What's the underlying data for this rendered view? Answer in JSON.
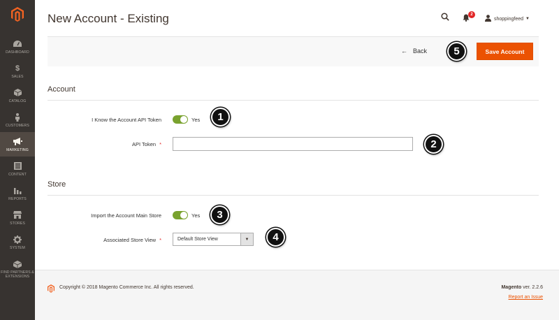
{
  "header": {
    "title": "New Account - Existing",
    "notification_count": "2",
    "user_name": "shoppingfeed"
  },
  "sidebar": {
    "items": [
      {
        "label": "DASHBOARD",
        "icon": "dashboard-icon"
      },
      {
        "label": "SALES",
        "icon": "dollar-icon"
      },
      {
        "label": "CATALOG",
        "icon": "box-icon"
      },
      {
        "label": "CUSTOMERS",
        "icon": "person-icon"
      },
      {
        "label": "MARKETING",
        "icon": "megaphone-icon"
      },
      {
        "label": "CONTENT",
        "icon": "content-icon"
      },
      {
        "label": "REPORTS",
        "icon": "bar-chart-icon"
      },
      {
        "label": "STORES",
        "icon": "store-icon"
      },
      {
        "label": "SYSTEM",
        "icon": "gear-icon"
      },
      {
        "label": "FIND PARTNERS & EXTENSIONS",
        "icon": "extensions-icon"
      }
    ],
    "active": "MARKETING"
  },
  "actions": {
    "back_label": "Back",
    "save_label": "Save Account"
  },
  "callouts": [
    "1",
    "2",
    "3",
    "4",
    "5"
  ],
  "account": {
    "title": "Account",
    "know_token_label": "I Know the Account API Token",
    "know_token_value": "Yes",
    "api_token_label": "API Token",
    "api_token_value": ""
  },
  "store": {
    "title": "Store",
    "import_store_label": "Import the Account Main Store",
    "import_store_value": "Yes",
    "store_view_label": "Associated Store View",
    "store_view_value": "Default Store View"
  },
  "footer": {
    "copyright": "Copyright © 2018 Magento Commerce Inc. All rights reserved.",
    "product": "Magento",
    "version": " ver. 2.2.6",
    "report": "Report an Issue"
  },
  "colors": {
    "accent": "#eb5202",
    "toggle_on": "#79a22e",
    "sidebar": "#373330"
  }
}
